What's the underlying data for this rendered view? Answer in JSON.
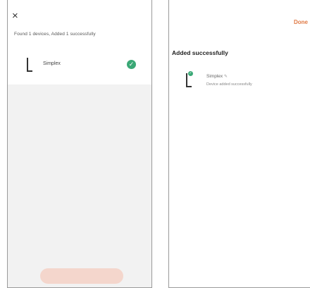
{
  "left_screen": {
    "close_icon": "×",
    "found_message": "Found 1 devices, Added 1 successfully",
    "device": {
      "name": "Simplex",
      "icon": "floor-lamp-icon",
      "status_icon": "check-circle-icon",
      "status_color": "#3aa876"
    },
    "bottom_button_color": "#f4d6cc"
  },
  "right_screen": {
    "done_label": "Done",
    "done_color": "#e07a45",
    "title": "Added successfully",
    "device": {
      "name": "Simplex",
      "status": "Device added successfully",
      "icon": "floor-lamp-icon",
      "edit_icon": "✎"
    }
  }
}
